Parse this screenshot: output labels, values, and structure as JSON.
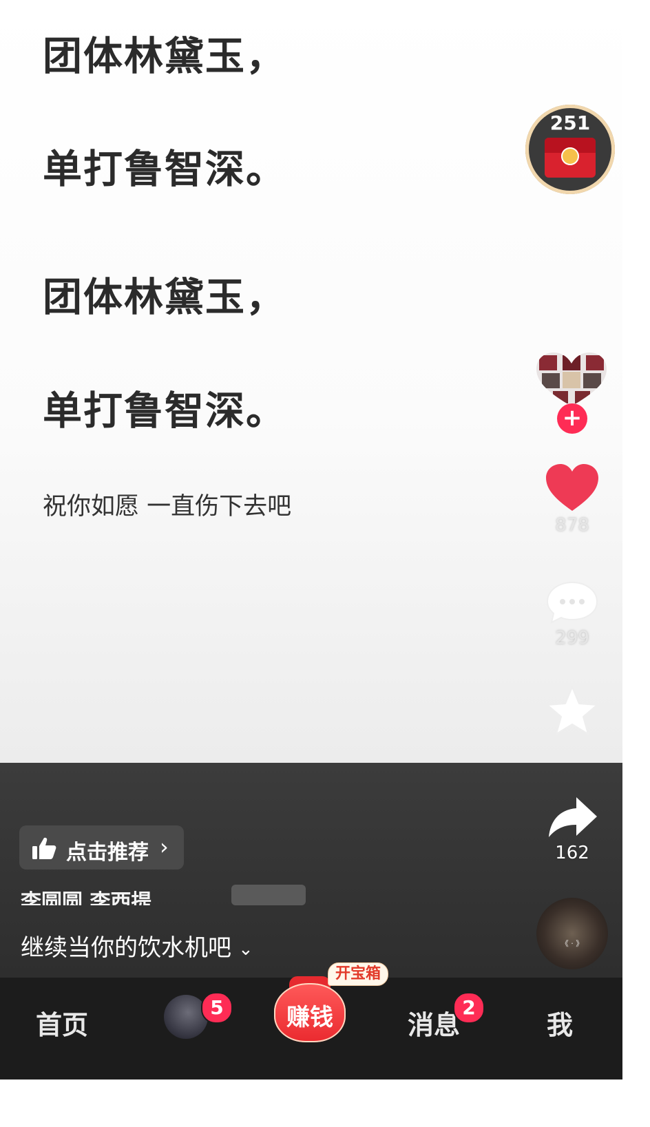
{
  "lyrics": {
    "line1": "团体林黛玉，",
    "line2": "单打鲁智深。",
    "line3": "团体林黛玉，",
    "line4": "单打鲁智深。",
    "subtitle": "祝你如愿 一直伤下去吧"
  },
  "red_packet": {
    "count": "251"
  },
  "actions": {
    "likes": "878",
    "comments": "299",
    "favorites": "",
    "shares": "162"
  },
  "recommend": {
    "label": "点击推荐"
  },
  "author": {
    "text": "李圆圆 李西提"
  },
  "caption": {
    "text": "继续当你的饮水机吧"
  },
  "tabbar": {
    "home": "首页",
    "friends_badge": "5",
    "earn": "赚钱",
    "chest": "开宝箱",
    "messages": "消息",
    "messages_badge": "2",
    "me": "我"
  },
  "colors": {
    "accent": "#fe2c55",
    "like": "#ee3a55",
    "tabbar_bg": "#1c1c1c"
  }
}
